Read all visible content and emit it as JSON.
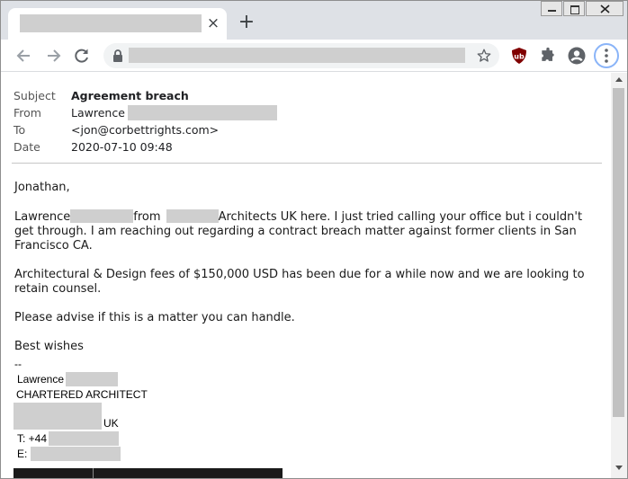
{
  "browser": {
    "tab": {
      "close_glyph": "×"
    },
    "new_tab_glyph": "+",
    "extensions": [
      "ublock-origin-icon",
      "puzzle-extensions-icon",
      "profile-avatar-icon"
    ]
  },
  "email": {
    "headers": {
      "subject_label": "Subject",
      "subject_value": "Agreement breach",
      "from_label": "From",
      "from_value": "Lawrence",
      "to_label": "To",
      "to_value": "<jon@corbettrights.com>",
      "date_label": "Date",
      "date_value": "2020-07-10 09:48"
    },
    "body": {
      "greeting": "Jonathan,",
      "p1_start": "Lawrence",
      "p1_from": "from",
      "p1_rest_line1": "Architects UK here. I just tried calling your office but i couldn't",
      "p1_rest": "get through. I am reaching out regarding a contract breach matter against former clients in San Francisco CA.",
      "p2": "Architectural & Design fees of $150,000 USD  has been due for a while now and we are looking to retain counsel.",
      "p3": "Please advise if this is a matter you can handle.",
      "closing": "Best wishes",
      "sig_sep": "--"
    },
    "signature": {
      "name": "Lawrence",
      "title": "CHARTERED ARCHITECT",
      "country": "UK",
      "phone_prefix": "T: +44",
      "email_prefix": "E:"
    }
  },
  "colors": {
    "chrome_tabstrip": "#dee1e6",
    "redaction": "#cfcfcf",
    "ublock_red": "#800000"
  }
}
